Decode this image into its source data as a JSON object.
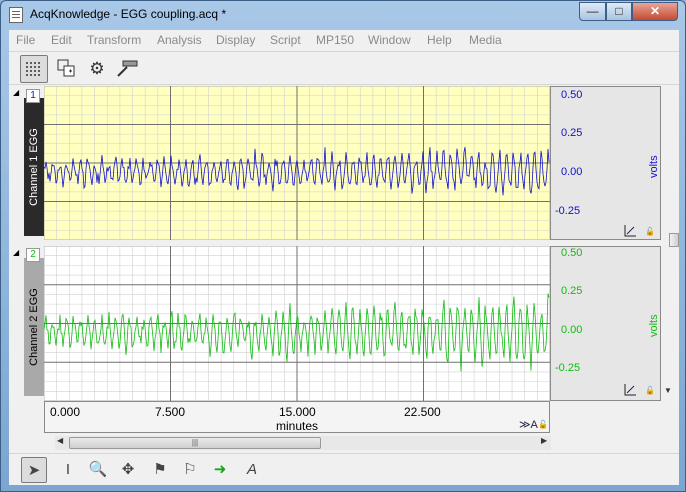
{
  "window": {
    "title": "AcqKnowledge - EGG coupling.acq *",
    "controls": {
      "minimize": "—",
      "maximize": "□",
      "close": "✕"
    }
  },
  "menubar": {
    "items": [
      "File",
      "Edit",
      "Transform",
      "Analysis",
      "Display",
      "Script",
      "MP150",
      "Window",
      "Help",
      "Media"
    ]
  },
  "toolbar": {
    "icons": [
      "grid-mode-icon",
      "channel-layout-icon",
      "settings-gear-icon",
      "scale-tool-icon"
    ]
  },
  "channels": [
    {
      "number": "1",
      "label": "Channel 1 EGG",
      "color": "#1010cc",
      "background": "#ffffc0",
      "label_bg": "#2a2a2a",
      "unit": "volts",
      "ticks": [
        "0.50",
        "0.25",
        "0.00",
        "-0.25"
      ],
      "tick_values": [
        0.5,
        0.25,
        0.0,
        -0.25
      ]
    },
    {
      "number": "2",
      "label": "Channel 2 EGG",
      "color": "#11bb11",
      "background": "#ffffff",
      "label_bg": "#a9a9a9",
      "unit": "volts",
      "ticks": [
        "0.50",
        "0.25",
        "0.00",
        "-0.25"
      ],
      "tick_values": [
        0.5,
        0.25,
        0.0,
        -0.25
      ]
    }
  ],
  "xaxis": {
    "ticks": [
      "0.000",
      "7.500",
      "15.000",
      "22.500"
    ],
    "label": "minutes"
  },
  "bottom_toolbar": {
    "tools": [
      "arrow-pointer-icon",
      "i-beam-icon",
      "zoom-icon",
      "scroll-move-icon",
      "flag-icon",
      "multi-flag-icon",
      "go-arrow-icon",
      "text-annotation-icon"
    ]
  }
}
